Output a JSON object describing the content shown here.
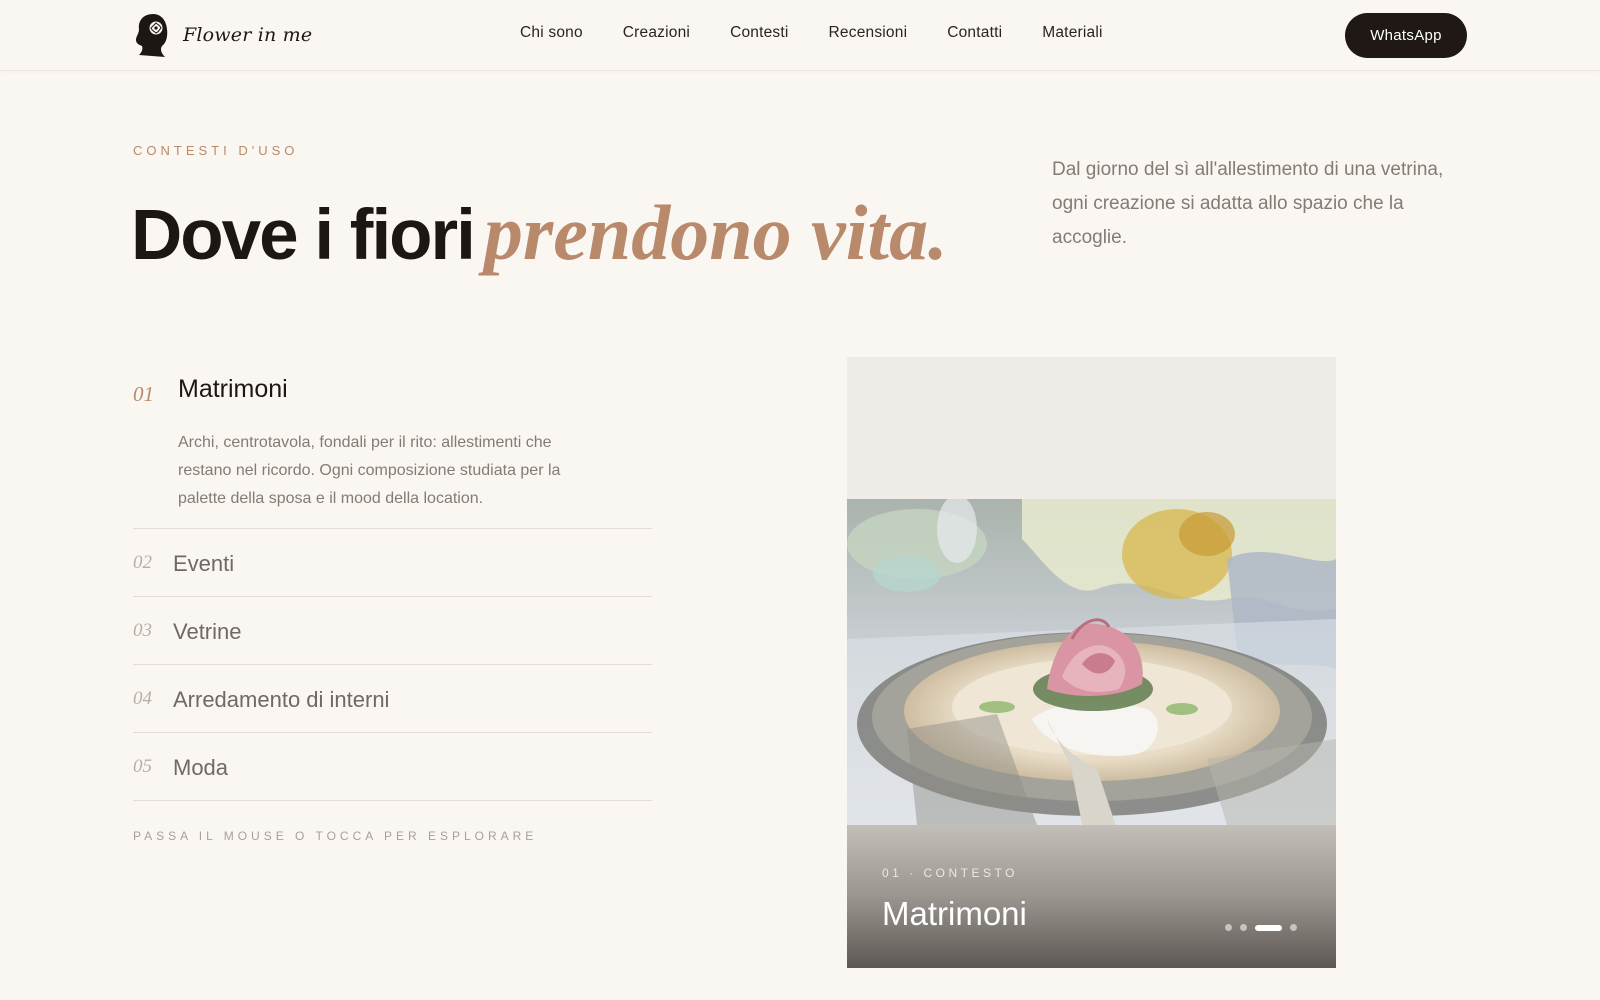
{
  "brand": {
    "name": "Flower in me"
  },
  "nav": {
    "items": [
      "Chi sono",
      "Creazioni",
      "Contesti",
      "Recensioni",
      "Contatti",
      "Materiali"
    ]
  },
  "cta": {
    "whatsapp_label": "WhatsApp"
  },
  "hero": {
    "eyebrow": "CONTESTI D'USO",
    "title_plain": "Dove i fiori",
    "title_accent": "prendono vita.",
    "intro": "Dal giorno del sì all'allestimento di una vetrina, ogni creazione si adatta allo spazio che la accoglie."
  },
  "contexts": [
    {
      "num": "01",
      "title": "Matrimoni",
      "description": "Archi, centrotavola, fondali per il rito: allestimenti che restano nel ricordo. Ogni composizione studiata per la palette della sposa e il mood della location.",
      "active": true
    },
    {
      "num": "02",
      "title": "Eventi"
    },
    {
      "num": "03",
      "title": "Vetrine"
    },
    {
      "num": "04",
      "title": "Arredamento di interni"
    },
    {
      "num": "05",
      "title": "Moda"
    }
  ],
  "hint": "PASSA IL MOUSE O TOCCA PER ESPLORARE",
  "card": {
    "tag": "01 · CONTESTO",
    "title": "Matrimoni",
    "slides": {
      "count": 4,
      "active_index": 2
    }
  },
  "colors": {
    "background": "#faf7f2",
    "accent": "#b8896b",
    "dark": "#1f1815",
    "muted_text": "#847b74"
  }
}
